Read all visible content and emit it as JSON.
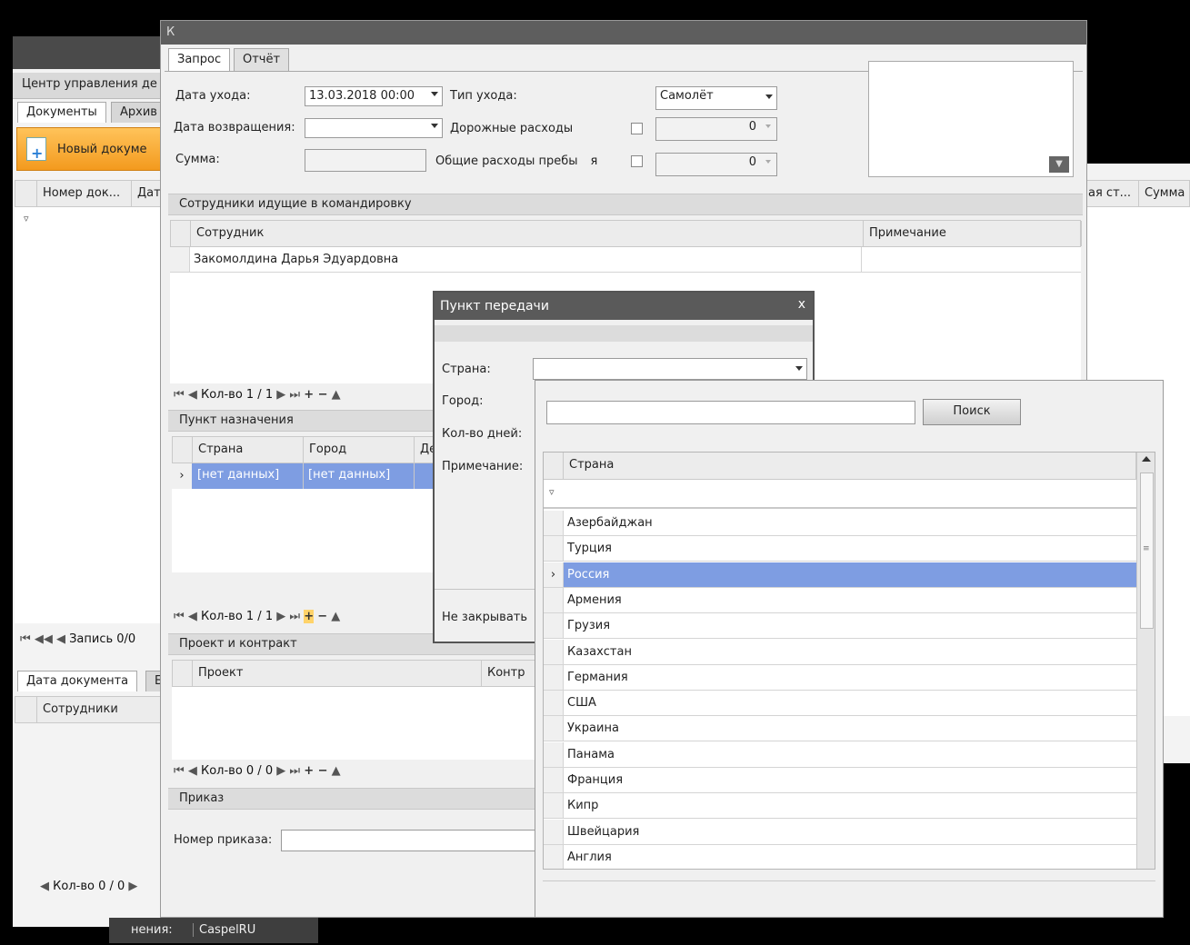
{
  "main_window": {
    "title": "Центр управления де",
    "tabs": [
      "Документы",
      "Архив"
    ],
    "new_doc_button": "Новый докуме",
    "grid_headers": [
      "Номер док...",
      "Дат"
    ],
    "right_headers": [
      "ая ст...",
      "Сумма"
    ],
    "record_nav": "Запись 0/0",
    "bottom_tabs": [
      "Дата документа",
      "Б"
    ],
    "bottom_grid_header": "Сотрудники",
    "bottom_nav": "Кол-во 0 / 0",
    "status_label": "нения:",
    "status_value": "CaspelRU"
  },
  "form": {
    "title_fragment": "К",
    "tabs": [
      "Запрос",
      "Отчёт"
    ],
    "leave_date_label": "Дата ухода:",
    "leave_date_value": "13.03.2018  00:00",
    "return_date_label": "Дата возвращения:",
    "return_date_value": "",
    "sum_label": "Сумма:",
    "leave_type_label": "Тип ухода:",
    "leave_type_value": "Самолёт",
    "travel_expenses_label": "Дорожные расходы",
    "travel_expenses_value": "0",
    "stay_expenses_label": "Общие расходы пребы",
    "stay_expenses_label_tail": "я",
    "stay_expenses_value": "0",
    "employees_section": "Сотрудники идущие в командировку",
    "employees_headers": [
      "Сотрудник",
      "Примечание"
    ],
    "employees_rows": [
      "Закомолдина Дарья Эдуардовна"
    ],
    "employees_nav": "Кол-во 1 / 1",
    "destination_section": "Пункт назначения",
    "destination_headers": [
      "Страна",
      "Город",
      "Де"
    ],
    "destination_row": [
      "[нет данных]",
      "[нет данных]"
    ],
    "destination_nav": "Кол-во 1 / 1",
    "project_section": "Проект и контракт",
    "project_headers": [
      "Проект",
      "Контр"
    ],
    "project_nav": "Кол-во 0 / 0",
    "order_section": "Приказ",
    "order_number_label": "Номер приказа:"
  },
  "transfer_dialog": {
    "title": "Пункт передачи",
    "close_glyph": "x",
    "country_label": "Страна:",
    "city_label": "Город:",
    "days_label": "Кол-во дней:",
    "note_label": "Примечание:",
    "keep_open_label": "Не закрывать"
  },
  "country_popup": {
    "search_value": "",
    "search_button": "Поиск",
    "column_header": "Страна",
    "selected_index": 2,
    "countries": [
      "Азербайджан",
      "Турция",
      "Россия",
      "Армения",
      "Грузия",
      "Казахстан",
      "Германия",
      "США",
      "Украина",
      "Панама",
      "Франция",
      "Кипр",
      "Швейцария",
      "Англия"
    ]
  },
  "colors": {
    "selection": "#7e9de2",
    "accent_orange": "#f6a52f",
    "dialog_title": "#5a5a5a"
  }
}
